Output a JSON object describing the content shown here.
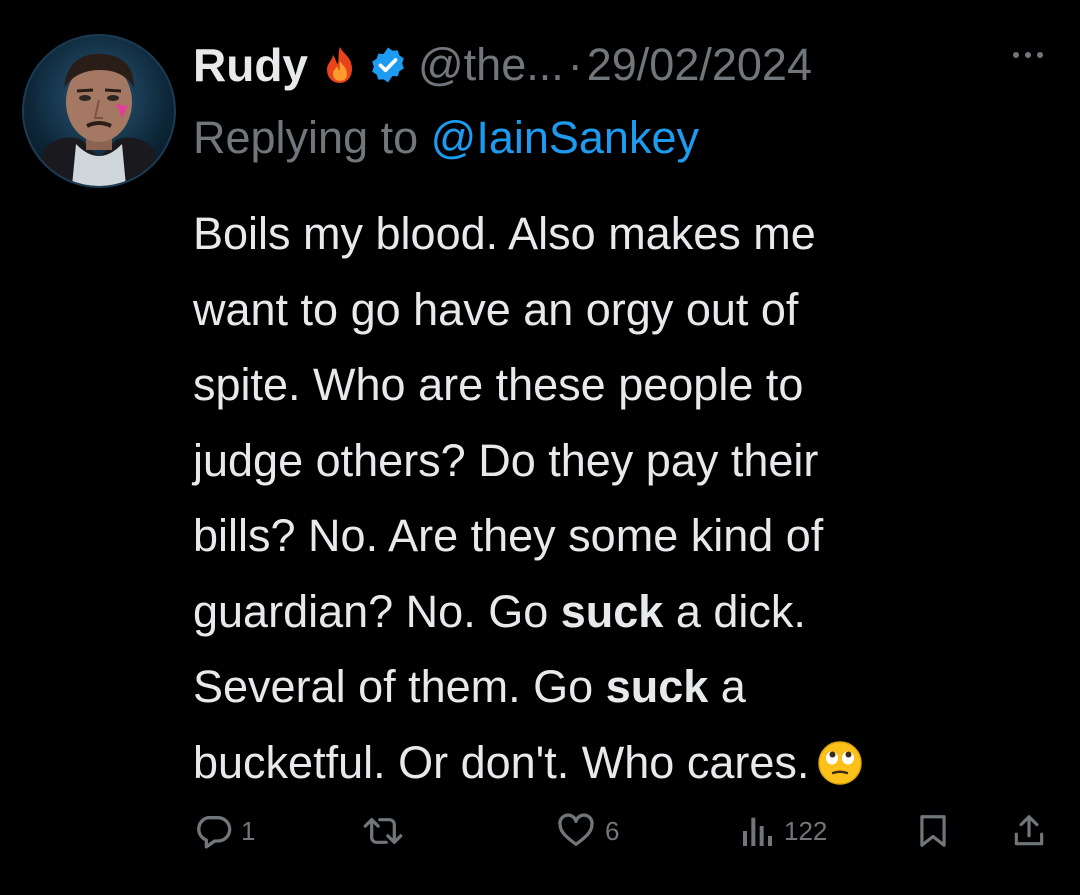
{
  "tweet": {
    "author_name": "Rudy",
    "handle": "@the...",
    "separator": "·",
    "date": "29/02/2024",
    "replying_prefix": "Replying to",
    "replying_to": "@IainSankey",
    "body_lines": [
      [
        {
          "t": "Boils my blood. Also makes me"
        }
      ],
      [
        {
          "t": "want to go have an orgy out of"
        }
      ],
      [
        {
          "t": "spite. Who are these people to"
        }
      ],
      [
        {
          "t": "judge others? Do they pay their"
        }
      ],
      [
        {
          "t": "bills? No. Are they some kind of"
        }
      ],
      [
        {
          "t": "guardian? No. Go "
        },
        {
          "t": "suck",
          "b": true
        },
        {
          "t": " a dick."
        }
      ],
      [
        {
          "t": "Several of them. Go "
        },
        {
          "t": "suck",
          "b": true
        },
        {
          "t": " a"
        }
      ],
      [
        {
          "t": "bucketful. Or don't. Who cares."
        }
      ]
    ],
    "emoji_name": "face-with-rolling-eyes-emoji"
  },
  "actions": {
    "replies": "1",
    "retweets": "",
    "likes": "6",
    "views": "122"
  },
  "colors": {
    "background": "#000000",
    "text": "#e7e9ea",
    "muted": "#71767b",
    "link": "#1d9bf0",
    "verified": "#1d9bf0"
  },
  "icons": [
    "fire-icon",
    "verified-badge-icon",
    "more-icon",
    "reply-icon",
    "retweet-icon",
    "like-icon",
    "views-icon",
    "bookmark-icon",
    "share-icon"
  ]
}
